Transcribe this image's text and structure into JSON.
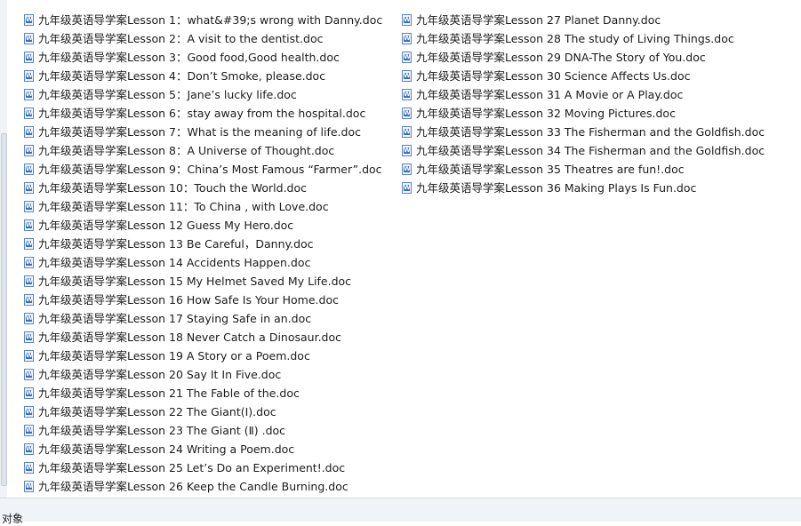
{
  "files_left": [
    "九年级英语导学案Lesson 1：what&#39;s wrong with Danny.doc",
    "九年级英语导学案Lesson 2：A visit to the dentist.doc",
    "九年级英语导学案Lesson 3：Good food,Good health.doc",
    "九年级英语导学案Lesson 4：Don’t Smoke, please.doc",
    "九年级英语导学案Lesson 5：Jane’s lucky life.doc",
    "九年级英语导学案Lesson 6：stay away from the  hospital.doc",
    "九年级英语导学案Lesson 7：What is the meaning of life.doc",
    "九年级英语导学案Lesson 8：A Universe of Thought.doc",
    "九年级英语导学案Lesson 9：China’s Most Famous “Farmer”.doc",
    "九年级英语导学案Lesson 10：Touch the World.doc",
    "九年级英语导学案Lesson 11：To China , with Love.doc",
    "九年级英语导学案Lesson 12  Guess My Hero.doc",
    "九年级英语导学案Lesson 13 Be Careful，Danny.doc",
    "九年级英语导学案Lesson 14 Accidents Happen.doc",
    "九年级英语导学案Lesson 15 My Helmet Saved My Life.doc",
    "九年级英语导学案Lesson 16 How Safe Is Your Home.doc",
    "九年级英语导学案Lesson 17 Staying Safe in an.doc",
    "九年级英语导学案Lesson 18 Never Catch a Dinosaur.doc",
    "九年级英语导学案Lesson 19 A Story or a Poem.doc",
    "九年级英语导学案Lesson 20 Say It In Five.doc",
    "九年级英语导学案Lesson 21 The Fable of the.doc",
    "九年级英语导学案Lesson 22 The Giant(Ⅰ).doc",
    "九年级英语导学案Lesson 23 The Giant (Ⅱ) .doc",
    "九年级英语导学案Lesson 24 Writing a Poem.doc",
    "九年级英语导学案Lesson 25 Let’s Do an Experiment!.doc",
    "九年级英语导学案Lesson 26 Keep the Candle Burning.doc"
  ],
  "files_right": [
    "九年级英语导学案Lesson 27 Planet  Danny.doc",
    "九年级英语导学案Lesson 28 The study of Living Things.doc",
    "九年级英语导学案Lesson 29 DNA-The Story of You.doc",
    "九年级英语导学案Lesson 30 Science Affects Us.doc",
    "九年级英语导学案Lesson 31 A Movie or A Play.doc",
    "九年级英语导学案Lesson 32 Moving Pictures.doc",
    "九年级英语导学案Lesson 33 The Fisherman and the Goldfish.doc",
    "九年级英语导学案Lesson 34 The Fisherman and the Goldfish.doc",
    "九年级英语导学案Lesson 35 Theatres are fun!.doc",
    "九年级英语导学案Lesson 36 Making Plays Is Fun.doc"
  ],
  "status_bar": {
    "text": "对象"
  },
  "icon": "word-document-icon"
}
